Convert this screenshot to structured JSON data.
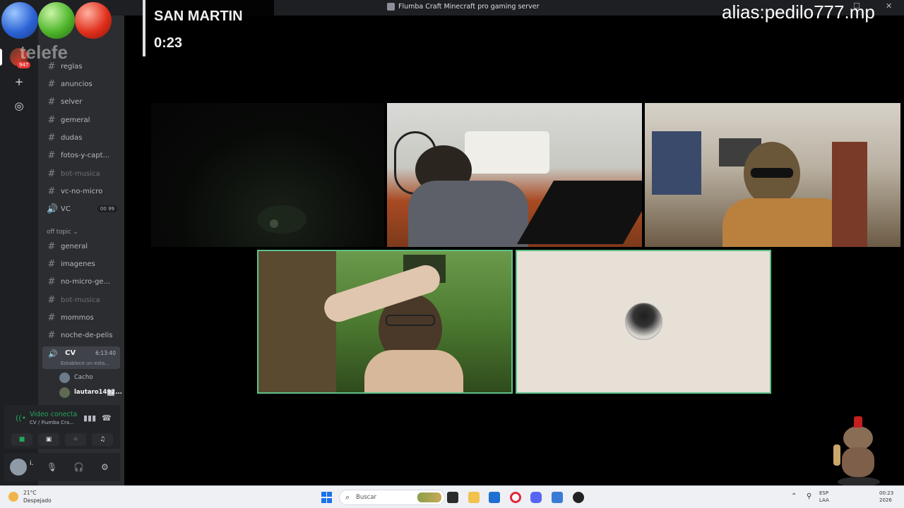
{
  "window": {
    "title": "Flumba Craft Minecraft pro gaming server"
  },
  "overlay": {
    "title": "SAN MARTIN",
    "time": "0:23",
    "logo": "telefe",
    "alias": "alias:pedilo777.mp"
  },
  "servers": {
    "badge": "947"
  },
  "channels": {
    "list": [
      {
        "name": "reglas"
      },
      {
        "name": "anuncios"
      },
      {
        "name": "selver"
      },
      {
        "name": "gemeral"
      },
      {
        "name": "dudas"
      },
      {
        "name": "fotos-y-capt..."
      },
      {
        "name": "bot-musica"
      },
      {
        "name": "vc-no-micro"
      }
    ],
    "vc": {
      "name": "VC",
      "count_a": "00",
      "count_b": "99"
    },
    "category": "off topic",
    "offtopic": [
      {
        "name": "general"
      },
      {
        "name": "imagenes"
      },
      {
        "name": "no-micro-ge..."
      },
      {
        "name": "bot-musica"
      },
      {
        "name": "mommos"
      },
      {
        "name": "noche-de-pelis"
      }
    ],
    "active": {
      "name": "CV",
      "time": "6:13:40",
      "status": "Establece un esta..."
    },
    "members": [
      {
        "name": "Cacho"
      },
      {
        "name": "lautaro1492..."
      }
    ]
  },
  "voice_panel": {
    "title": "Video conecta",
    "subtitle": "CV / Fiumba Cra..."
  },
  "user_panel": {
    "name": "i."
  },
  "taskbar": {
    "weather_temp": "21°C",
    "weather_desc": "Despejado",
    "search_placeholder": "Buscar",
    "lang_top": "ESP",
    "lang_bottom": "LAA",
    "time": "00:23",
    "date": "2026"
  }
}
